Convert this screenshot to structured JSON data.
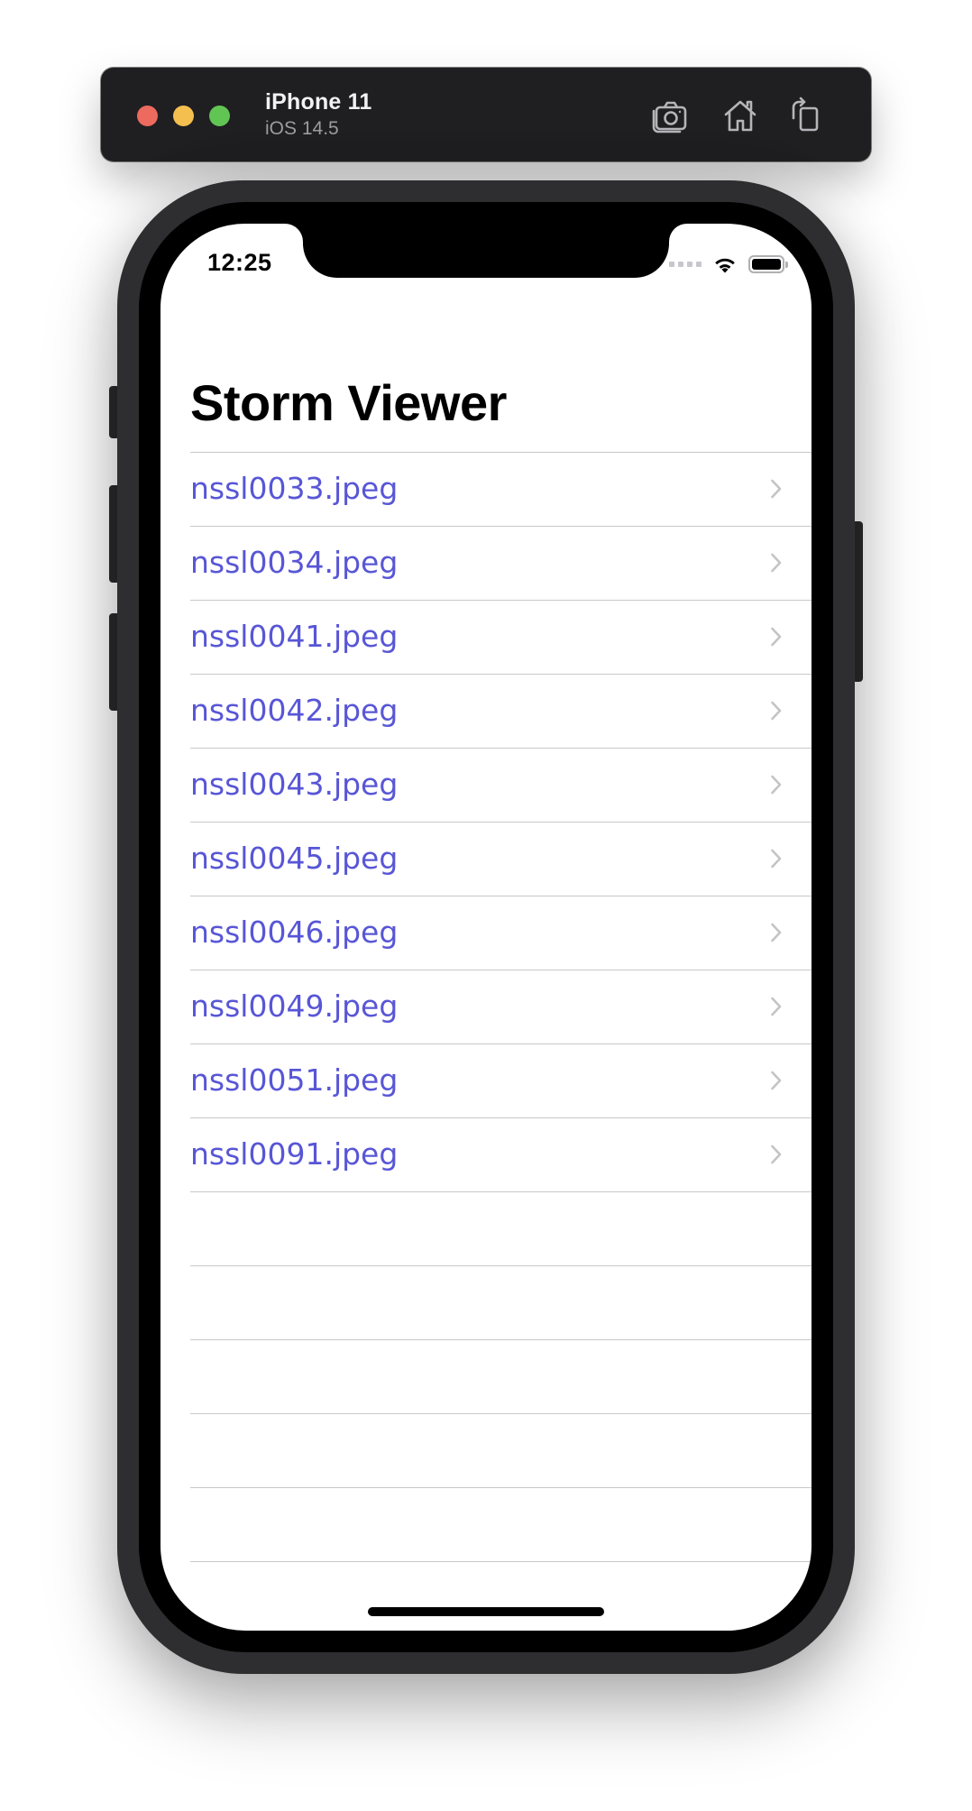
{
  "simulator": {
    "device_name": "iPhone 11",
    "os_version": "iOS 14.5",
    "toolbar_icons": [
      "screenshot-icon",
      "home-icon",
      "rotate-icon"
    ]
  },
  "status_bar": {
    "time": "12:25",
    "icons": [
      "cellular-signal-icon",
      "wifi-icon",
      "battery-icon"
    ]
  },
  "nav": {
    "title": "Storm Viewer"
  },
  "table": {
    "rows": [
      {
        "label": "nssl0033.jpeg"
      },
      {
        "label": "nssl0034.jpeg"
      },
      {
        "label": "nssl0041.jpeg"
      },
      {
        "label": "nssl0042.jpeg"
      },
      {
        "label": "nssl0043.jpeg"
      },
      {
        "label": "nssl0045.jpeg"
      },
      {
        "label": "nssl0046.jpeg"
      },
      {
        "label": "nssl0049.jpeg"
      },
      {
        "label": "nssl0051.jpeg"
      },
      {
        "label": "nssl0091.jpeg"
      }
    ],
    "accessory_icon": "chevron-right-icon",
    "empty_row_count": 5
  },
  "colors": {
    "row_text": "#5856d6",
    "separator": "#c8c7cc",
    "toolbar_bg": "#1f1f22"
  }
}
